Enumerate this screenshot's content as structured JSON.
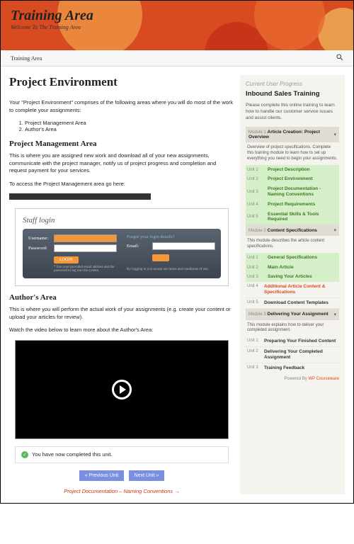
{
  "header": {
    "title": "Training Area",
    "tagline": "Welcome To The Training Area"
  },
  "nav": {
    "link": "Training Area"
  },
  "page": {
    "title": "Project Environment",
    "intro": "Your \"Project Environment\" comprises of the following areas where you will do most of the work to complete your assignments:",
    "list": [
      "Project Management Area",
      "Author's Area"
    ],
    "h2a": "Project Management Area",
    "p1": "This is where you are assigned new work and download all of your new assignments, communicate with the project manager, notify us of project progress and completion and request payment for your services.",
    "p2": "To access the Project Management area go here:",
    "staff": {
      "title": "Staff login",
      "user": "Username:",
      "pass": "Password:",
      "login": "LOGIN",
      "note": "* Use your provided email address and the password to log into the system.",
      "forgot": "Forgot your login details?",
      "email": "Email:",
      "terms": "By logging in you accept our terms and conditions of use."
    },
    "h2b": "Author's Area",
    "p3": "This is where you will perform the actual work of your assignments (e.g. create your content or upload your articles for review).",
    "p4": "Watch the video below to learn more about the Author's Area:",
    "completed": "You have now completed this unit.",
    "prev": "« Previous Unit",
    "next": "Next Unit »",
    "nextlink": "Project Documentation – Naming Conventions →"
  },
  "sidebar": {
    "heading": "Current User Progress",
    "title": "Inbound Sales Training",
    "desc": "Please complete this online training to learn how to handle our customer service issues and assist clients.",
    "modules": [
      {
        "num": "Module 1",
        "title": "Article Creation: Project Overview",
        "desc": "Overview of project specifications. Complete this training module to learn how to set up everything you need to begin your assignments.",
        "units": [
          {
            "u": "Unit 1",
            "n": "Project Description",
            "s": "done"
          },
          {
            "u": "Unit 2",
            "n": "Project Environment",
            "s": "done"
          },
          {
            "u": "Unit 3",
            "n": "Project Documentation - Naming Conventions",
            "s": "done"
          },
          {
            "u": "Unit 4",
            "n": "Project Requirements",
            "s": "done"
          },
          {
            "u": "Unit 5",
            "n": "Essential Skills & Tools Required",
            "s": "done"
          }
        ]
      },
      {
        "num": "Module 2",
        "title": "Content Specifications",
        "desc": "This module describes the article content specifications.",
        "units": [
          {
            "u": "Unit 1",
            "n": "General Specifications",
            "s": "done"
          },
          {
            "u": "Unit 2",
            "n": "Main Article",
            "s": "done"
          },
          {
            "u": "Unit 3",
            "n": "Saving Your Articles",
            "s": "done"
          },
          {
            "u": "Unit 4",
            "n": "Additional Article Content & Specifications",
            "s": "current"
          },
          {
            "u": "Unit 5",
            "n": "Download Content Templates",
            "s": ""
          }
        ]
      },
      {
        "num": "Module 3",
        "title": "Delivering Your Assignment",
        "desc": "This module explains how to deliver your completed assignment.",
        "units": [
          {
            "u": "Unit 1",
            "n": "Preparing Your Finished Content",
            "s": ""
          },
          {
            "u": "Unit 2",
            "n": "Delivering Your Completed Assignment",
            "s": ""
          },
          {
            "u": "Unit 3",
            "n": "Training Feedback",
            "s": ""
          }
        ]
      }
    ],
    "powered": "Powered By ",
    "wp": "WP Courseware"
  }
}
